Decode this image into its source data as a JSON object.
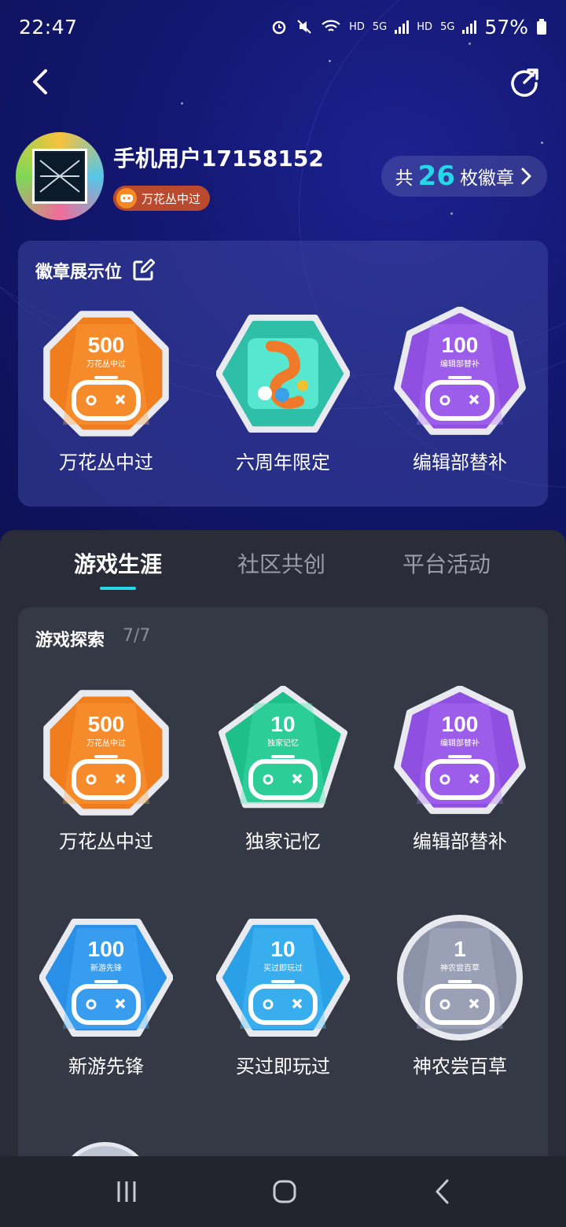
{
  "status_bar": {
    "time": "22:47",
    "network_labels": [
      "HD",
      "5G",
      "HD",
      "5G"
    ],
    "battery": "57%"
  },
  "nav": {
    "back_icon": "chevron-left-icon",
    "share_icon": "share-icon"
  },
  "profile": {
    "username": "手机用户17158152",
    "tag": "万花丛中过",
    "badge_count_prefix": "共",
    "badge_count": "26",
    "badge_count_suffix": "枚徽章"
  },
  "showcase": {
    "title": "徽章展示位",
    "badges": [
      {
        "name": "万花丛中过",
        "number": "500",
        "subtitle": "万花丛中过",
        "shape": "octagon",
        "color": "#f07d1e"
      },
      {
        "name": "六周年限定",
        "number": "",
        "subtitle": "",
        "shape": "hexagon",
        "color": "#2fbfa8"
      },
      {
        "name": "编辑部替补",
        "number": "100",
        "subtitle": "编辑部替补",
        "shape": "heptagon",
        "color": "#8f4fe0"
      }
    ]
  },
  "tabs": [
    {
      "label": "游戏生涯",
      "active": true
    },
    {
      "label": "社区共创",
      "active": false
    },
    {
      "label": "平台活动",
      "active": false
    }
  ],
  "explore": {
    "title": "游戏探索",
    "count": "7/7",
    "badges": [
      {
        "name": "万花丛中过",
        "number": "500",
        "subtitle": "万花丛中过",
        "shape": "octagon",
        "color": "#f07d1e"
      },
      {
        "name": "独家记忆",
        "number": "10",
        "subtitle": "独家记忆",
        "shape": "pentagon",
        "color": "#1fbf8a"
      },
      {
        "name": "编辑部替补",
        "number": "100",
        "subtitle": "编辑部替补",
        "shape": "heptagon",
        "color": "#8f4fe0"
      },
      {
        "name": "新游先锋",
        "number": "100",
        "subtitle": "新游先锋",
        "shape": "hexagon",
        "color": "#2a8fe6"
      },
      {
        "name": "买过即玩过",
        "number": "10",
        "subtitle": "买过即玩过",
        "shape": "hexagon",
        "color": "#2aa0e6"
      },
      {
        "name": "神农尝百草",
        "number": "1",
        "subtitle": "神农尝百草",
        "shape": "circle",
        "color": "#8c93a8"
      }
    ]
  },
  "system_nav": {
    "recents_icon": "recents-icon",
    "home_icon": "home-icon",
    "back_icon": "back-icon"
  }
}
